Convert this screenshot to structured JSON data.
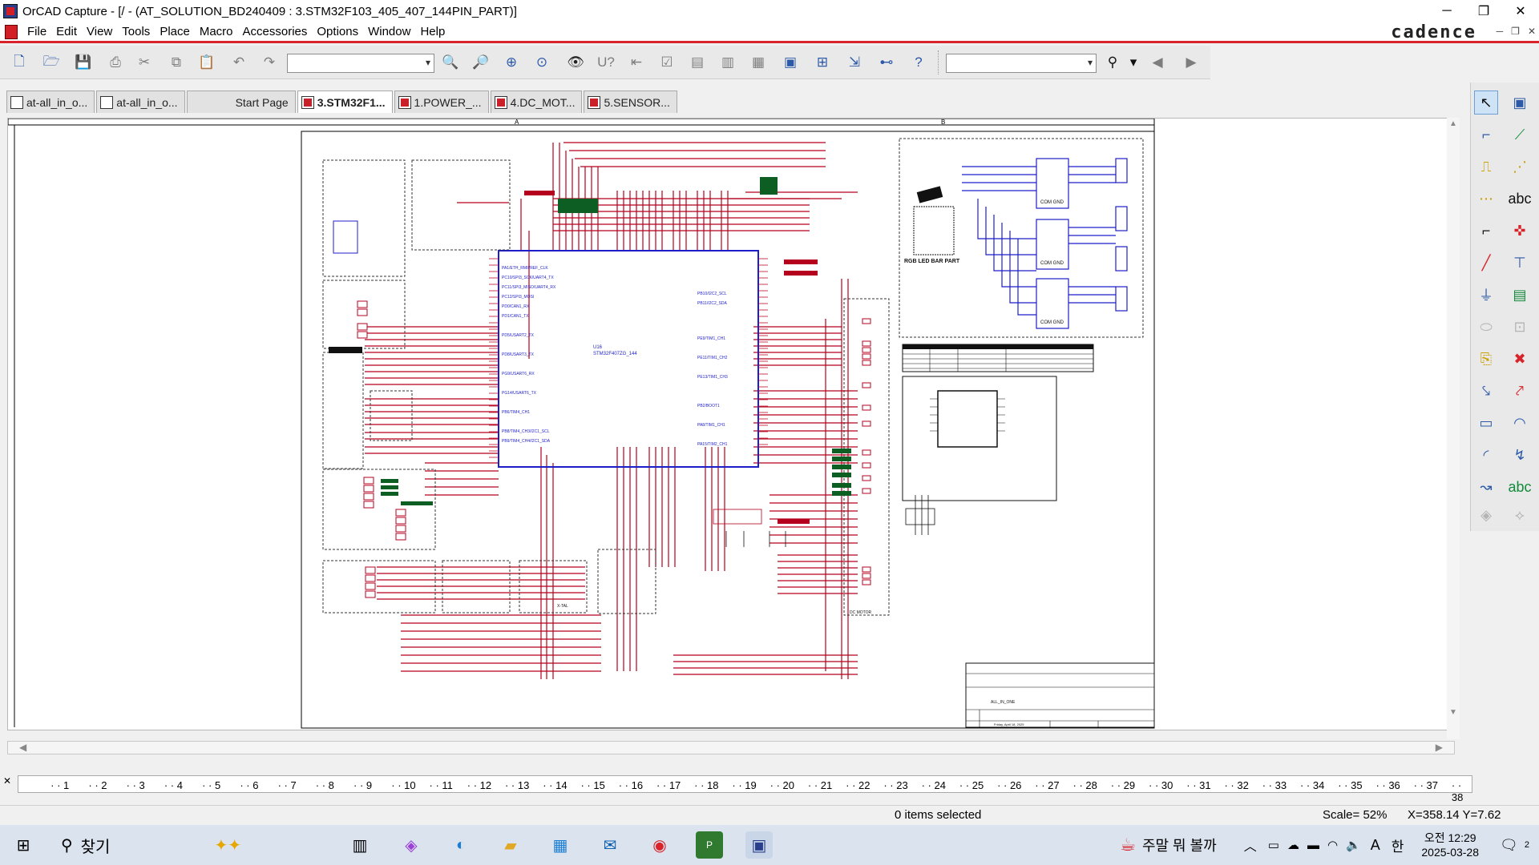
{
  "window": {
    "title": "OrCAD Capture - [/ - (AT_SOLUTION_BD240409 : 3.STM32F103_405_407_144PIN_PART)]",
    "minimize": "─",
    "restore": "❐",
    "close": "✕"
  },
  "menu": {
    "items": [
      "File",
      "Edit",
      "View",
      "Tools",
      "Place",
      "Macro",
      "Accessories",
      "Options",
      "Window",
      "Help"
    ],
    "brand": "cadence",
    "mdi": [
      "─",
      "❐",
      "✕"
    ]
  },
  "toolbar": {
    "part_combo": "",
    "search_combo": "",
    "icons": [
      "new-icon",
      "open-icon",
      "save-icon",
      "print-icon",
      "cut-icon",
      "copy-icon",
      "paste-icon",
      "undo-icon",
      "redo-icon",
      "zoom-in-icon",
      "zoom-out-icon",
      "zoom-area-icon",
      "zoom-all-icon",
      "eye-icon",
      "find-icon"
    ]
  },
  "tabs": [
    {
      "label": "at-all_in_o...",
      "icon": "schematic-icon"
    },
    {
      "label": "at-all_in_o...",
      "icon": "schematic-icon"
    },
    {
      "label": "Start Page",
      "icon": ""
    },
    {
      "label": "3.STM32F1...",
      "icon": "page-icon",
      "active": true
    },
    {
      "label": "1.POWER_...",
      "icon": "page-icon"
    },
    {
      "label": "4.DC_MOT...",
      "icon": "page-icon"
    },
    {
      "label": "5.SENSOR...",
      "icon": "page-icon"
    }
  ],
  "schematic": {
    "chip_name": "STM32F407ZG_144",
    "chip_ref": "U16",
    "block_labels": {
      "rgb": "RGB LED BAR PART",
      "xtal": "X-TAL",
      "dc_motor": "DC MOTOR",
      "title_block": "ALL_IN_ONE",
      "title_date": "Friday, April 18, 2025"
    },
    "driver_label": "COM GND",
    "zone_top_a": "A",
    "zone_top_b": "B"
  },
  "ruler": {
    "marks": [
      "1",
      "2",
      "3",
      "4",
      "5",
      "6",
      "7",
      "8",
      "9",
      "10",
      "11",
      "12",
      "13",
      "14",
      "15",
      "16",
      "17",
      "18",
      "19",
      "20",
      "21",
      "22",
      "23",
      "24",
      "25",
      "26",
      "27",
      "28",
      "29",
      "30",
      "31",
      "32",
      "33",
      "34",
      "35",
      "36",
      "37",
      "38"
    ]
  },
  "status": {
    "selection": "0 items selected",
    "scale": "Scale= 52%",
    "coords": "X=358.14  Y=7.62"
  },
  "taskbar": {
    "search": "찾기",
    "weather": "주말 뭐 볼까",
    "ime": "한",
    "font_a": "A",
    "time": "오전 12:29",
    "date": "2025-03-28",
    "notif_count": "2"
  },
  "colors": {
    "wire_red": "#b4001c",
    "wire_blue": "#1d1dc9",
    "accent_red": "#d8232a"
  }
}
